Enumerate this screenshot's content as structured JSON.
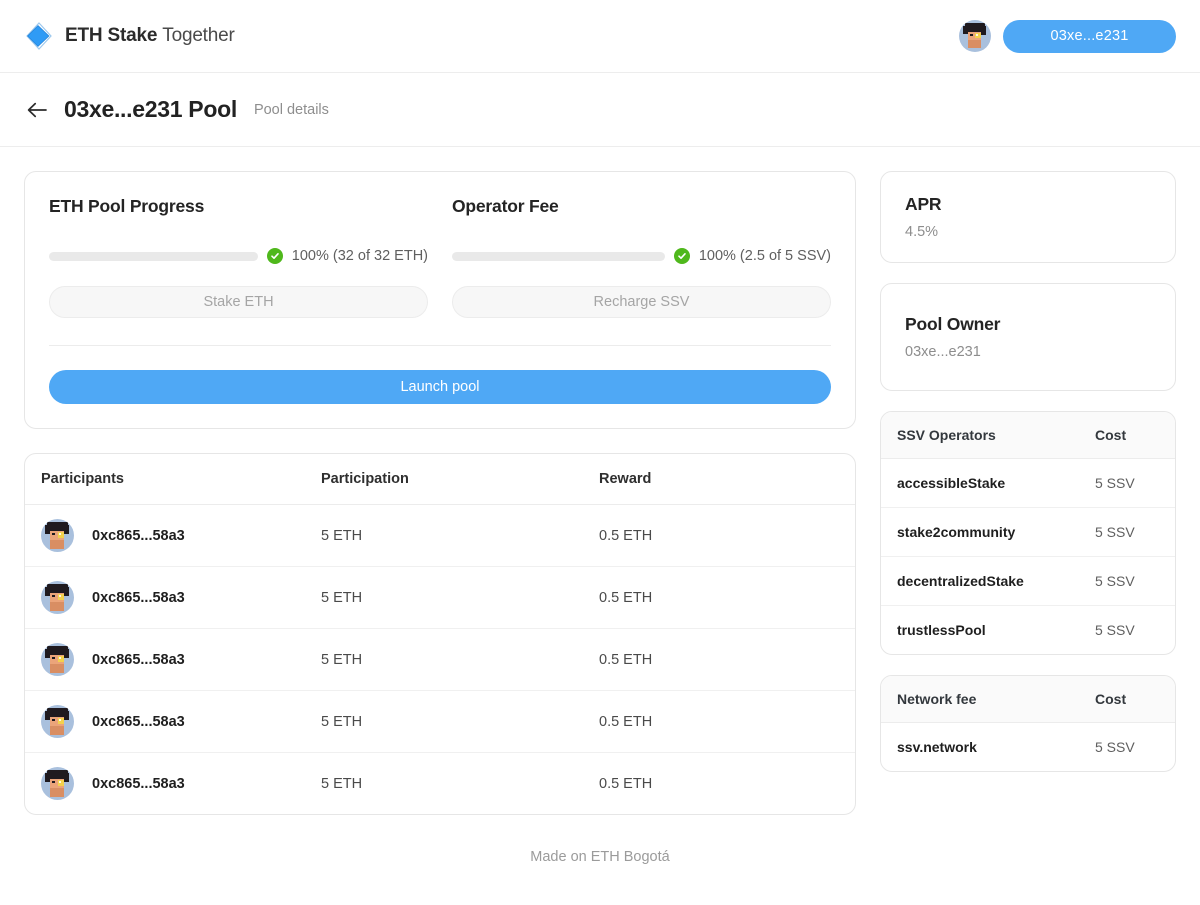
{
  "brand": {
    "name_bold": "ETH Stake",
    "name_light": "Together",
    "logo_color": "#2f9bf5"
  },
  "header": {
    "wallet_label": "03xe...e231",
    "wallet_color": "#4fa8f5",
    "avatar_name": "user-avatar"
  },
  "page": {
    "back_icon": "arrow-left-icon",
    "title": "03xe...e231 Pool",
    "subtitle": "Pool details"
  },
  "pool": {
    "eth": {
      "heading": "ETH Pool Progress",
      "percent": 100,
      "progress_label": "100% (32 of 32 ETH)",
      "bar_color": "#4fb81c",
      "button_label": "Stake ETH",
      "button_disabled": true
    },
    "operator": {
      "heading": "Operator Fee",
      "percent": 100,
      "progress_label": "100% (2.5 of 5 SSV)",
      "bar_color": "#4fb81c",
      "button_label": "Recharge SSV",
      "button_disabled": true
    },
    "launch_label": "Launch pool"
  },
  "participants_table": {
    "headers": [
      "Participants",
      "Participation",
      "Reward"
    ],
    "rows": [
      {
        "address": "0xc865...58a3",
        "participation": "5 ETH",
        "reward": "0.5 ETH"
      },
      {
        "address": "0xc865...58a3",
        "participation": "5 ETH",
        "reward": "0.5 ETH"
      },
      {
        "address": "0xc865...58a3",
        "participation": "5 ETH",
        "reward": "0.5 ETH"
      },
      {
        "address": "0xc865...58a3",
        "participation": "5 ETH",
        "reward": "0.5 ETH"
      },
      {
        "address": "0xc865...58a3",
        "participation": "5 ETH",
        "reward": "0.5 ETH"
      }
    ]
  },
  "sidebar": {
    "apr": {
      "title": "APR",
      "value": "4.5%"
    },
    "owner": {
      "title": "Pool Owner",
      "value": "03xe...e231"
    },
    "operators": {
      "headers": [
        "SSV Operators",
        "Cost"
      ],
      "rows": [
        {
          "name": "accessibleStake",
          "cost": "5 SSV"
        },
        {
          "name": "stake2community",
          "cost": "5 SSV"
        },
        {
          "name": "decentralizedStake",
          "cost": "5 SSV"
        },
        {
          "name": "trustlessPool",
          "cost": "5 SSV"
        }
      ]
    },
    "network_fee": {
      "headers": [
        "Network fee",
        "Cost"
      ],
      "rows": [
        {
          "name": "ssv.network",
          "cost": "5 SSV"
        }
      ]
    }
  },
  "footer": {
    "text": "Made on ETH Bogotá"
  }
}
